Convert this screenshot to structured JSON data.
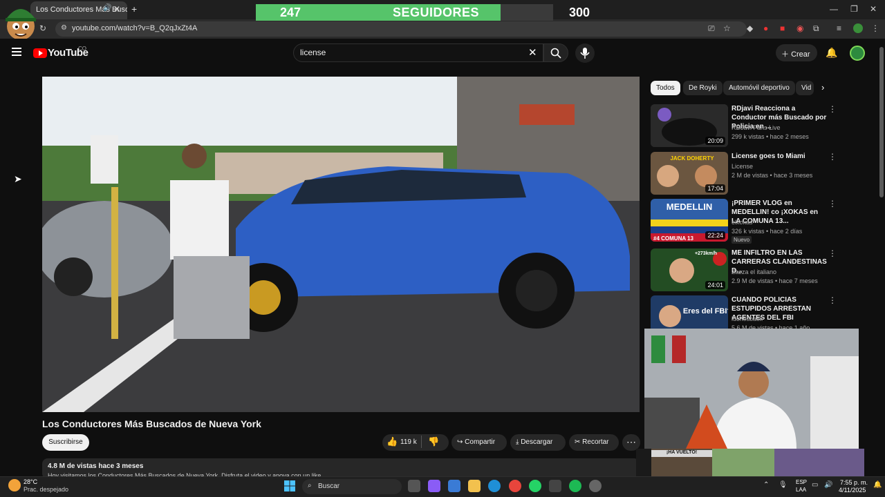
{
  "browser": {
    "tab_title": "Los Conductores Más Buscados",
    "url": "youtube.com/watch?v=B_Q2qJxZt4A",
    "new_tab": "+"
  },
  "follower_goal": {
    "current": "247",
    "label": "SEGUIDORES",
    "goal": "300",
    "progress": 0.823
  },
  "youtube": {
    "logo_text": "YouTube",
    "country": "CO",
    "search_value": "license",
    "create_label": "Crear"
  },
  "video": {
    "title": "Los Conductores Más Buscados de Nueva York",
    "subscribe_label": "Suscribirse",
    "likes": "119 k",
    "share_label": "Compartir",
    "download_label": "Descargar",
    "clip_label": "Recortar",
    "views_line": "4.8 M de vistas  hace 3 meses",
    "description_line": "Hoy visitamos los Conductores Más Buscados de Nueva York. Disfruta el video y apoya con un like."
  },
  "chips": [
    "Todos",
    "De Royki",
    "Automóvil deportivo",
    "Vid"
  ],
  "recommendations": [
    {
      "title": "RDjavi Reacciona a Conductor más Buscado por Policia en ...",
      "channel": "RDJavi Fans Live",
      "meta": "299 k vistas • hace 2 meses",
      "duration": "20:09",
      "badge": "",
      "color": "#3b3b3b"
    },
    {
      "title": "License goes to Miami",
      "channel": "License",
      "meta": "2 M de vistas • hace 3 meses",
      "duration": "17:04",
      "badge": "",
      "color": "#5a4a3a"
    },
    {
      "title": "¡PRIMER VLOG en MEDELLIN! co ¡XOKAS en LA COMUNA 13...",
      "channel": "elxokas",
      "meta": "326 k vistas • hace 2 días",
      "duration": "22:24",
      "badge": "Nuevo",
      "color": "#3d6fb3"
    },
    {
      "title": "ME INFILTRO EN LAS CARRERAS CLANDESTINAS D...",
      "channel": "Zazza el italiano",
      "meta": "2.9 M de vistas • hace 7 meses",
      "duration": "24:01",
      "badge": "",
      "color": "#2d5a2d"
    },
    {
      "title": "CUANDO POLICIAS ESTUPIDOS ARRESTAN AGENTES DEL FBI",
      "channel": "luchosback",
      "meta": "5.6 M de vistas • hace 1 año",
      "duration": "",
      "badge": "",
      "color": "#1f3b66"
    }
  ],
  "thumb_text": {
    "jack": "JACK DOHERTY",
    "medellin": "MEDELLIN",
    "comuna": "#4  COMUNA 13",
    "speed": "+273km/h",
    "fbi": "Eres del FBI?"
  },
  "overlay": {
    "banner": "¡HA VUELTO!"
  },
  "taskbar": {
    "temp": "28°C",
    "weather": "Prac. despejado",
    "search": "Buscar",
    "lang1": "ESP",
    "lang2": "LAA",
    "time": "7:55 p. m.",
    "date": "4/11/2025"
  }
}
